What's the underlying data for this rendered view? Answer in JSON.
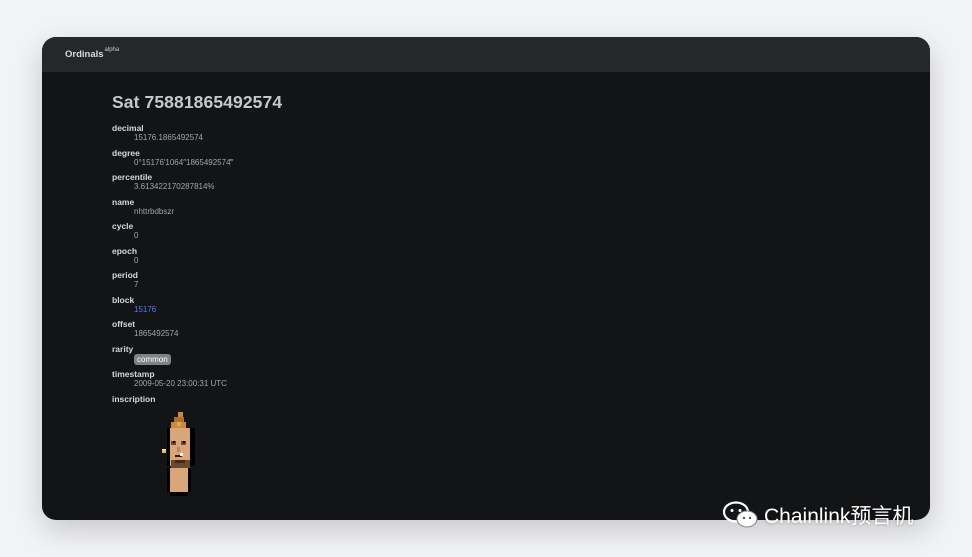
{
  "header": {
    "brand": "Ordinals",
    "brand_tag": "alpha"
  },
  "page_title": "Sat 75881865492574",
  "fields": [
    {
      "key": "decimal",
      "value": "15176.1865492574"
    },
    {
      "key": "degree",
      "value": "0°15176′1064″1865492574‴"
    },
    {
      "key": "percentile",
      "value": "3.613422170287814%"
    },
    {
      "key": "name",
      "value": "nhttrbdbszr"
    },
    {
      "key": "cycle",
      "value": "0"
    },
    {
      "key": "epoch",
      "value": "0"
    },
    {
      "key": "period",
      "value": "7"
    },
    {
      "key": "block",
      "value": "15176"
    },
    {
      "key": "offset",
      "value": "1865492574"
    },
    {
      "key": "rarity",
      "value": "common"
    },
    {
      "key": "timestamp",
      "value": "2009-05-20 23:00:31 UTC"
    },
    {
      "key": "inscription",
      "value": ""
    }
  ],
  "colors": {
    "background": "#131416",
    "header": "#25272b",
    "link": "#4d7dff",
    "rarity_badge": "#808184"
  },
  "inscription_image": "pixel-punk-portrait",
  "watermark": {
    "icon": "wechat-icon",
    "text": "Chainlink预言机"
  }
}
